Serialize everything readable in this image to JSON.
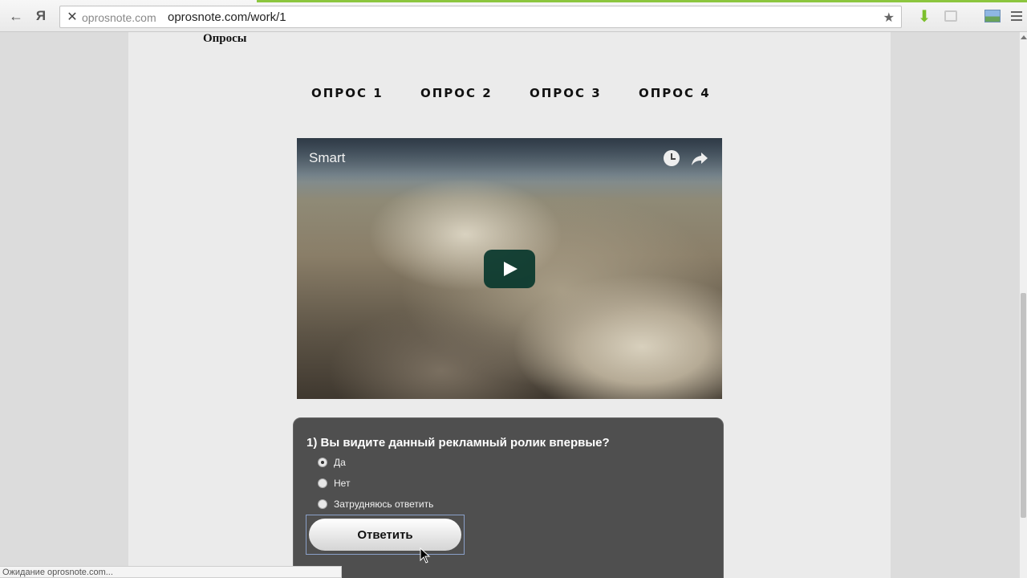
{
  "browser": {
    "address_host": "oprosnote.com",
    "address_url_host": "oprosnote.com",
    "address_url_path": "/work/1",
    "ya_label": "Я",
    "status_text": "Ожидание oprosnote.com..."
  },
  "page": {
    "heading": "Опросы",
    "tabs": [
      {
        "label": "Опрос 1"
      },
      {
        "label": "Опрос 2"
      },
      {
        "label": "Опрос 3"
      },
      {
        "label": "Опрос 4"
      }
    ]
  },
  "video": {
    "title": "Smart"
  },
  "poll": {
    "question": "1) Вы видите данный рекламный ролик впервые?",
    "options": [
      {
        "label": "Да",
        "checked": true
      },
      {
        "label": "Нет",
        "checked": false
      },
      {
        "label": "Затрудняюсь ответить",
        "checked": false
      }
    ],
    "submit_label": "Ответить"
  },
  "colors": {
    "panel": "#4f4f4f",
    "load_bar": "#8cc63f",
    "play_button": "#08372d"
  }
}
